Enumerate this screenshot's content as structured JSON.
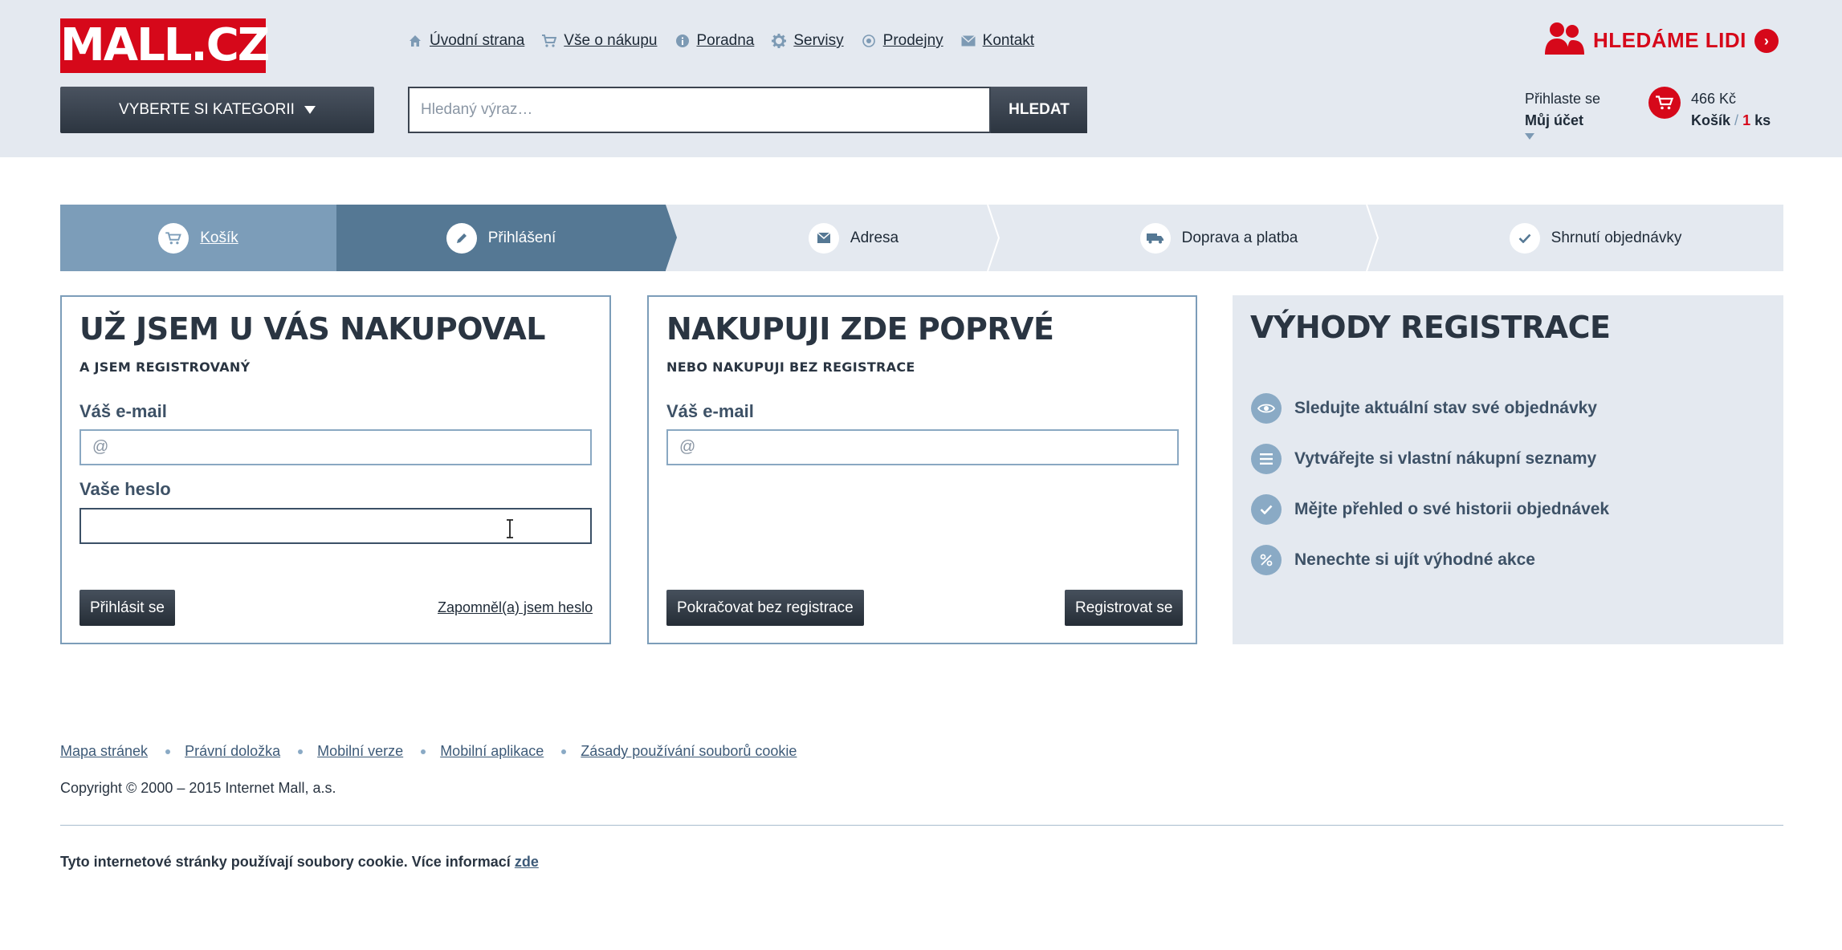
{
  "header": {
    "logo": "MALL.CZ",
    "nav": [
      {
        "label": "Úvodní strana",
        "icon": "home-icon"
      },
      {
        "label": "Vše o nákupu",
        "icon": "cart-icon"
      },
      {
        "label": "Poradna",
        "icon": "info-icon"
      },
      {
        "label": "Servisy",
        "icon": "gear-icon"
      },
      {
        "label": "Prodejny",
        "icon": "location-icon"
      },
      {
        "label": "Kontakt",
        "icon": "mail-icon"
      }
    ],
    "hiring": "HLEDÁME LIDI",
    "category_button": "VYBERTE SI KATEGORII",
    "search": {
      "placeholder": "Hledaný výraz…",
      "button": "HLEDAT"
    },
    "account": {
      "line1": "Přihlaste se",
      "line2": "Můj účet"
    },
    "cart": {
      "price": "466 Kč",
      "label": "Košík",
      "separator": "/",
      "count": "1",
      "unit": "ks"
    }
  },
  "steps": [
    {
      "label": "Košík",
      "icon": "cart-icon"
    },
    {
      "label": "Přihlášení",
      "icon": "pencil-icon"
    },
    {
      "label": "Adresa",
      "icon": "envelope-icon"
    },
    {
      "label": "Doprava a platba",
      "icon": "truck-icon"
    },
    {
      "label": "Shrnutí objednávky",
      "icon": "check-icon"
    }
  ],
  "login": {
    "title": "UŽ JSEM U VÁS NAKUPOVAL",
    "subtitle": "A JSEM REGISTROVANÝ",
    "email_label": "Váš e-mail",
    "email_placeholder": "@",
    "password_label": "Vaše heslo",
    "login_button": "Přihlásit se",
    "forgot_link": "Zapomněl(a) jsem heslo"
  },
  "new_customer": {
    "title": "NAKUPUJI ZDE POPRVÉ",
    "subtitle": "NEBO NAKUPUJI BEZ REGISTRACE",
    "email_label": "Váš e-mail",
    "email_placeholder": "@",
    "continue_button": "Pokračovat bez registrace",
    "register_button": "Registrovat se"
  },
  "benefits": {
    "title": "VÝHODY REGISTRACE",
    "items": [
      {
        "text": "Sledujte aktuální stav své objednávky",
        "icon": "eye-icon"
      },
      {
        "text": "Vytvářejte si vlastní nákupní seznamy",
        "icon": "list-icon"
      },
      {
        "text": "Mějte přehled o své historii objednávek",
        "icon": "check-icon"
      },
      {
        "text": "Nenechte si ujít výhodné akce",
        "icon": "percent-icon"
      }
    ]
  },
  "footer": {
    "links": [
      "Mapa stránek",
      "Právní doložka",
      "Mobilní verze",
      "Mobilní aplikace",
      "Zásady používání souborů cookie"
    ],
    "copyright": "Copyright © 2000 – 2015 Internet Mall, a.s.",
    "cookie_text": "Tyto internetové stránky používají soubory cookie. Více informací",
    "cookie_link": "zde"
  },
  "colors": {
    "brand_red": "#d6081a",
    "header_bg": "#e4e9f0",
    "step_active": "#557894",
    "step_done": "#7c9db9"
  }
}
